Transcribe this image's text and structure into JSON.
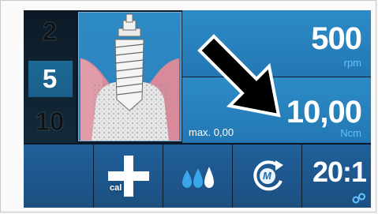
{
  "programs": {
    "items": [
      "2",
      "5",
      "10"
    ],
    "active_index": 1
  },
  "speed": {
    "value": "500",
    "unit": "rpm"
  },
  "torque": {
    "value": "10,00",
    "unit": "Ncm",
    "max_label": "max. 0,00"
  },
  "buttons": {
    "calibration": {
      "icon": "calibration-cross-icon",
      "label": "cal"
    },
    "irrigation": {
      "icon": "irrigation-drops-icon",
      "level": 3
    },
    "motor_direction": {
      "icon": "motor-rotation-icon",
      "label": "M"
    },
    "ratio": {
      "label": "20:1",
      "icon": "gear-icon"
    }
  },
  "overlay": {
    "icon": "arrow-down-right-icon"
  },
  "colors": {
    "accent": "#2d8bc6",
    "button": "#1c5589",
    "unit_text": "#62c2ff",
    "background": "#0a1a2a"
  }
}
